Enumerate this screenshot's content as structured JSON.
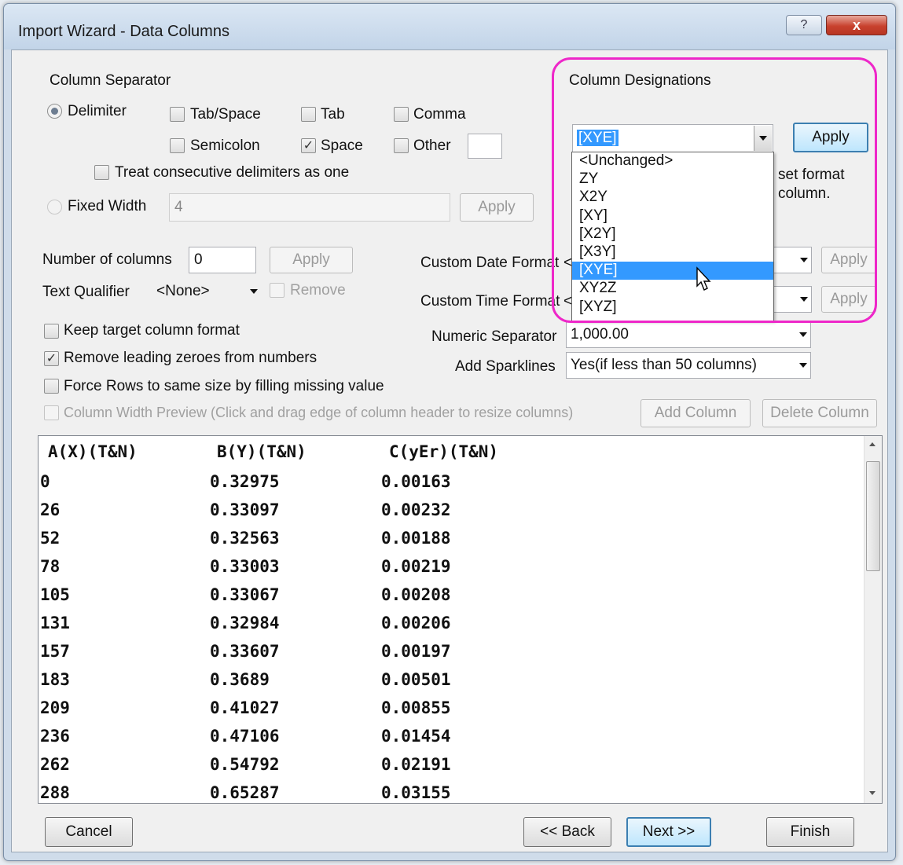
{
  "window": {
    "title": "Import Wizard - Data Columns",
    "help_label": "?",
    "close_label": "x"
  },
  "separator": {
    "group_label": "Column Separator",
    "delimiter_label": "Delimiter",
    "tab_space": "Tab/Space",
    "tab": "Tab",
    "comma": "Comma",
    "semicolon": "Semicolon",
    "space": "Space",
    "other": "Other",
    "consecutive": "Treat consecutive delimiters as one",
    "fixed_width_label": "Fixed Width",
    "fixed_width_value": "4",
    "apply_label": "Apply",
    "checked_mark": "✓"
  },
  "designations": {
    "group_label": "Column Designations",
    "selected": "[XYE]",
    "apply_label": "Apply",
    "hint_line1": "set format",
    "hint_line2": "column.",
    "options": [
      "<Unchanged>",
      "ZY",
      "X2Y",
      "[XY]",
      "[X2Y]",
      "[X3Y]",
      "[XYE]",
      "XY2Z",
      "[XYZ]"
    ]
  },
  "columns": {
    "number_label": "Number of columns",
    "number_value": "0",
    "apply_label": "Apply",
    "qualifier_label": "Text Qualifier",
    "qualifier_value": "<None>",
    "remove_label": "Remove"
  },
  "formats": {
    "date_label": "Custom Date Format",
    "date_value": "<",
    "time_label": "Custom Time Format",
    "time_value": "<",
    "apply_label": "Apply",
    "numeric_label": "Numeric Separator",
    "numeric_value": "1,000.00",
    "sparklines_label": "Add Sparklines",
    "sparklines_value": "Yes(if less than 50 columns)"
  },
  "options": {
    "keep_format": "Keep target column format",
    "remove_zeros": "Remove leading zeroes from numbers",
    "force_rows": "Force Rows to same size by filling missing value",
    "width_preview": "Column Width Preview (Click and drag edge of column header to resize columns)",
    "add_column": "Add Column",
    "delete_column": "Delete Column"
  },
  "preview": {
    "headers": [
      "A(X)(T&N)",
      "B(Y)(T&N)",
      "C(yEr)(T&N)"
    ],
    "rows": [
      [
        "0",
        "0.32975",
        "0.00163"
      ],
      [
        "26",
        "0.33097",
        "0.00232"
      ],
      [
        "52",
        "0.32563",
        "0.00188"
      ],
      [
        "78",
        "0.33003",
        "0.00219"
      ],
      [
        "105",
        "0.33067",
        "0.00208"
      ],
      [
        "131",
        "0.32984",
        "0.00206"
      ],
      [
        "157",
        "0.33607",
        "0.00197"
      ],
      [
        "183",
        "0.3689",
        "0.00501"
      ],
      [
        "209",
        "0.41027",
        "0.00855"
      ],
      [
        "236",
        "0.47106",
        "0.01454"
      ],
      [
        "262",
        "0.54792",
        "0.02191"
      ],
      [
        "288",
        "0.65287",
        "0.03155"
      ]
    ]
  },
  "footer": {
    "cancel": "Cancel",
    "back": "<< Back",
    "next": "Next >>",
    "finish": "Finish"
  },
  "colors": {
    "highlight": "#ee27c9",
    "selection": "#3399ff",
    "title_bar": "#c2d4e8"
  }
}
